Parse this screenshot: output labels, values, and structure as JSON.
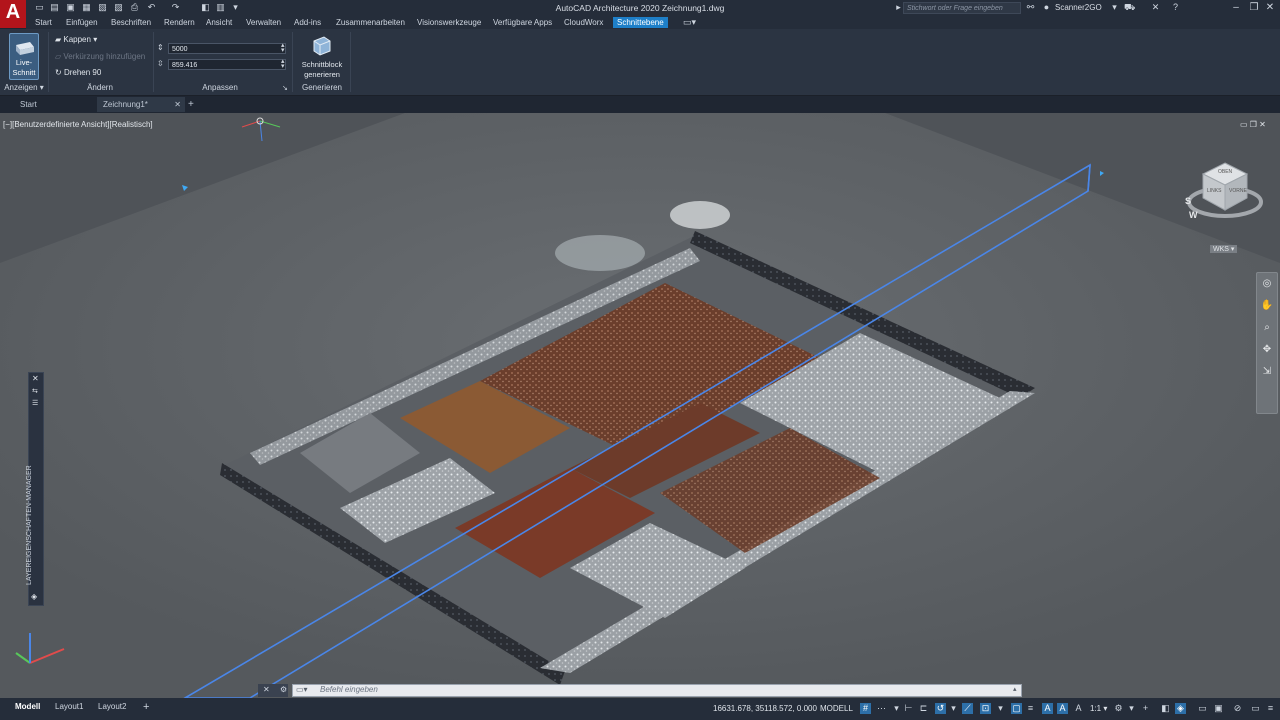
{
  "window": {
    "logo_letter": "A",
    "title": "AutoCAD Architecture 2020   Zeichnung1.dwg",
    "search_placeholder": "Stichwort oder Frage eingeben",
    "user": "Scanner2GO"
  },
  "menu_tabs": [
    "Start",
    "Einfügen",
    "Beschriften",
    "Rendern",
    "Ansicht",
    "Verwalten",
    "Add-ins",
    "Zusammenarbeiten",
    "Visionswerkzeuge",
    "Verfügbare Apps",
    "CloudWorx",
    "Schnittebene"
  ],
  "ribbon": {
    "live_button": "Live-Schnitt",
    "panel_anzeigen": "Anzeigen",
    "kappen": "Kappen",
    "verkuerzung": "Verkürzung hinzufügen",
    "drehen": "Drehen 90",
    "panel_aendern": "Ändern",
    "spin1_value": "5000",
    "spin2_value": "859.416",
    "panel_anpassen": "Anpassen",
    "schnittblock_line1": "Schnittblock",
    "schnittblock_line2": "generieren",
    "panel_generieren": "Generieren"
  },
  "file_tabs": {
    "start": "Start",
    "drawing": "Zeichnung1*",
    "close": "✕",
    "add": "+"
  },
  "viewport": {
    "label": "[−][Benutzerdefinierte Ansicht][Realistisch]",
    "viewcube_top": "OBEN",
    "viewcube_left": "LINKS",
    "viewcube_right": "VORNE",
    "compass_w": "W",
    "compass_s": "S",
    "wcs": "WKS"
  },
  "palette_title": "LAYEREIGENSCHAFTEN-MANAGER",
  "command_placeholder": "Befehl eingeben",
  "status": {
    "tabs": [
      "Modell",
      "Layout1",
      "Layout2"
    ],
    "coords": "16631.678, 35118.572, 0.000",
    "space": "MODELL",
    "scale": "1:1"
  },
  "colors": {
    "accent": "#1e7fc8",
    "section_plane": "#4a86e8"
  }
}
